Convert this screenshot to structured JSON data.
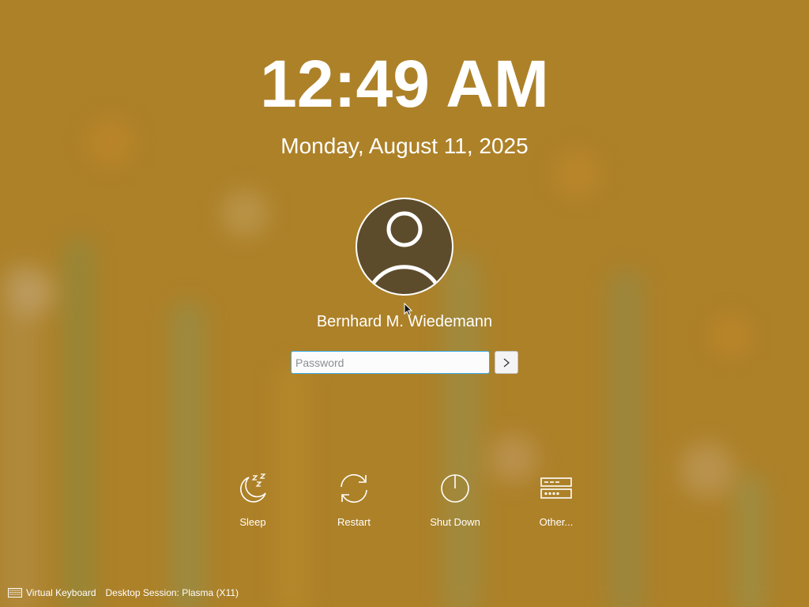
{
  "lockscreen": {
    "time": "12:49 AM",
    "date": "Monday, August 11, 2025",
    "user_name": "Bernhard M. Wiedemann",
    "password_placeholder": "Password"
  },
  "actions": {
    "sleep_label": "Sleep",
    "restart_label": "Restart",
    "shutdown_label": "Shut Down",
    "other_label": "Other..."
  },
  "footer": {
    "virtual_keyboard_label": "Virtual Keyboard",
    "session_label": "Desktop Session: Plasma (X11)"
  },
  "icons": {
    "avatar": "user-avatar-icon",
    "login": "chevron-right-icon",
    "sleep": "sleep-moon-icon",
    "restart": "restart-icon",
    "shutdown": "power-icon",
    "other": "other-actions-icon",
    "keyboard": "keyboard-icon"
  },
  "colors": {
    "background": "#ad8128",
    "avatar_fill": "#5d4c2c",
    "focus_border": "#3daee9",
    "text": "#ffffff"
  }
}
